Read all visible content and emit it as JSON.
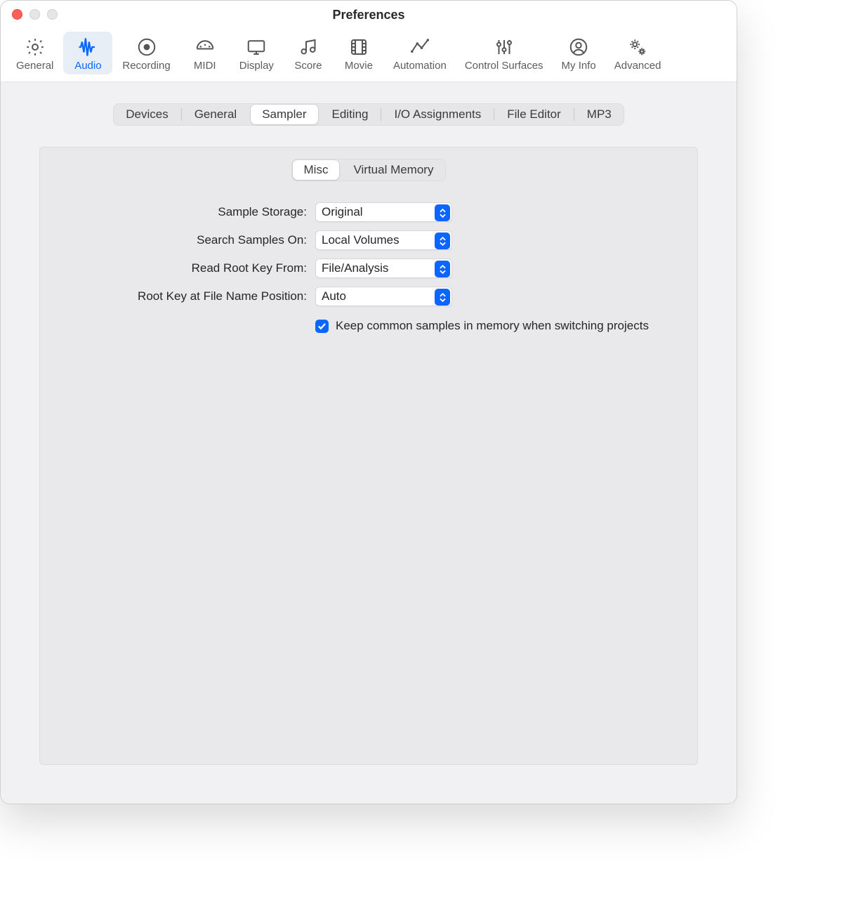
{
  "window": {
    "title": "Preferences"
  },
  "toolbar": {
    "items": [
      {
        "label": "General"
      },
      {
        "label": "Audio"
      },
      {
        "label": "Recording"
      },
      {
        "label": "MIDI"
      },
      {
        "label": "Display"
      },
      {
        "label": "Score"
      },
      {
        "label": "Movie"
      },
      {
        "label": "Automation"
      },
      {
        "label": "Control Surfaces"
      },
      {
        "label": "My Info"
      },
      {
        "label": "Advanced"
      }
    ],
    "selected": "Audio"
  },
  "tabs": {
    "items": [
      "Devices",
      "General",
      "Sampler",
      "Editing",
      "I/O Assignments",
      "File Editor",
      "MP3"
    ],
    "selected": "Sampler"
  },
  "subtabs": {
    "items": [
      "Misc",
      "Virtual Memory"
    ],
    "selected": "Misc"
  },
  "form": {
    "sample_storage": {
      "label": "Sample Storage:",
      "value": "Original"
    },
    "search_samples_on": {
      "label": "Search Samples On:",
      "value": "Local Volumes"
    },
    "read_root_key_from": {
      "label": "Read Root Key From:",
      "value": "File/Analysis"
    },
    "root_key_position": {
      "label": "Root Key at File Name Position:",
      "value": "Auto"
    },
    "keep_common": {
      "label": "Keep common samples in memory when switching projects",
      "checked": true
    }
  }
}
